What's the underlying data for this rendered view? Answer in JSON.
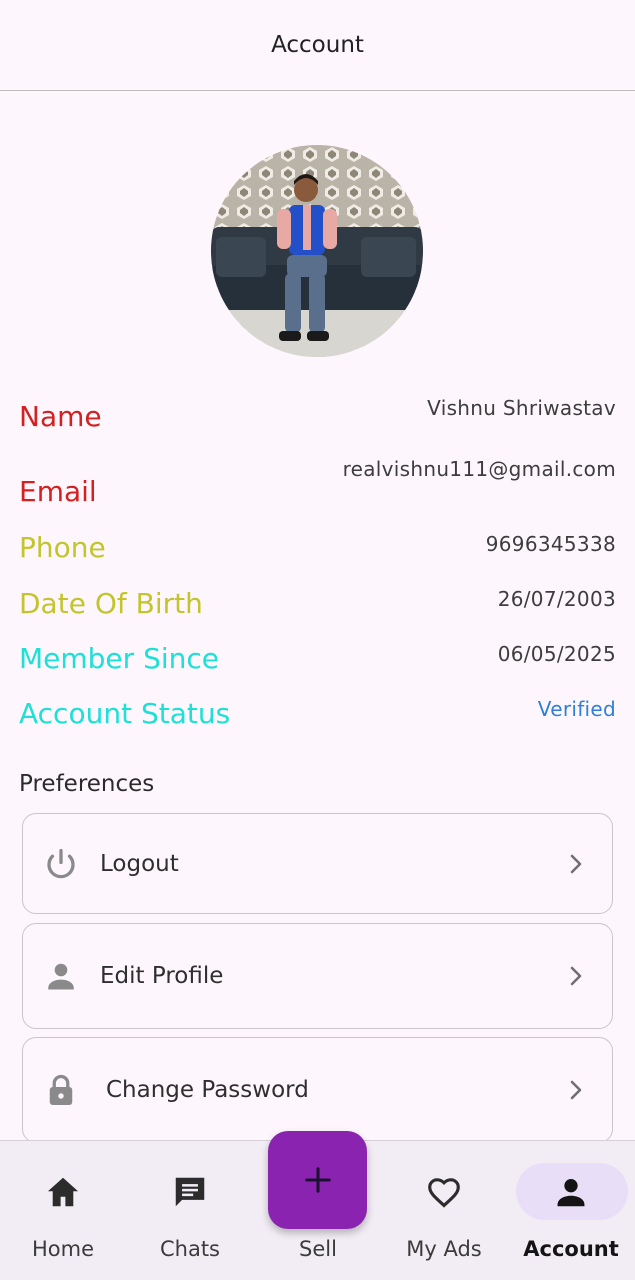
{
  "app_bar": {
    "title": "Account"
  },
  "profile": {
    "fields": [
      {
        "label": "Name",
        "value": "Vishnu Shriwastav",
        "label_color": "#d32020"
      },
      {
        "label": "Email",
        "value": "realvishnu111@gmail.com",
        "label_color": "#d32020"
      },
      {
        "label": "Phone",
        "value": "9696345338",
        "label_color": "#c4c42c"
      },
      {
        "label": "Date Of Birth",
        "value": "26/07/2003",
        "label_color": "#c4c42c"
      },
      {
        "label": "Member Since",
        "value": "06/05/2025",
        "label_color": "#1ee0d6"
      },
      {
        "label": "Account Status",
        "value": "Verified",
        "label_color": "#1ee0d6",
        "value_color": "#2f7fd8"
      }
    ]
  },
  "preferences": {
    "title": "Preferences",
    "items": [
      {
        "label": "Logout",
        "icon": "power-icon"
      },
      {
        "label": "Edit Profile",
        "icon": "person-icon"
      },
      {
        "label": "Change Password",
        "icon": "lock-icon"
      }
    ]
  },
  "bottom_nav": {
    "items": [
      {
        "label": "Home",
        "icon": "home-icon"
      },
      {
        "label": "Chats",
        "icon": "chat-icon"
      },
      {
        "label": "Sell",
        "icon": "plus-icon"
      },
      {
        "label": "My Ads",
        "icon": "heart-outline-icon"
      },
      {
        "label": "Account",
        "icon": "account-icon",
        "active": true
      }
    ],
    "fab_color": "#8a24b0",
    "active_pill_color": "#e8def8"
  }
}
